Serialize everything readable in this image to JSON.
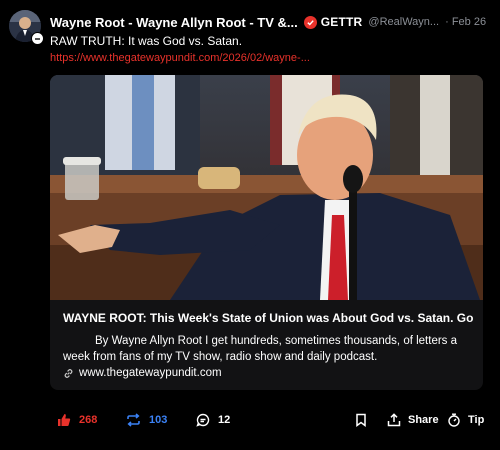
{
  "author": {
    "display_name": "Wayne Root - Wayne Allyn Root - TV &...",
    "platform": "GETTR",
    "handle": "@RealWayn...",
    "date": "Feb 26"
  },
  "post": {
    "text": "RAW TRUTH: It was God vs. Satan.",
    "link": "https://www.thegatewaypundit.com/2026/02/wayne-..."
  },
  "card": {
    "title": "WAYNE ROOT: This Week's State of Union was About God vs. Satan. God ...",
    "description": "By Wayne Allyn Root I get hundreds, sometimes thousands, of letters a week from fans of my TV show, radio show and daily podcast.",
    "domain": "www.thegatewaypundit.com"
  },
  "actions": {
    "likes": "268",
    "reposts": "103",
    "comments": "12",
    "share_label": "Share",
    "tip_label": "Tip"
  },
  "colors": {
    "accent_red": "#e8322b",
    "repost_blue": "#3b82f6",
    "muted": "#8b8f96"
  },
  "icons": [
    "avatar",
    "verified-check-icon",
    "link-icon",
    "like-icon",
    "repost-icon",
    "comment-icon",
    "bookmark-icon",
    "share-icon",
    "tip-icon"
  ]
}
